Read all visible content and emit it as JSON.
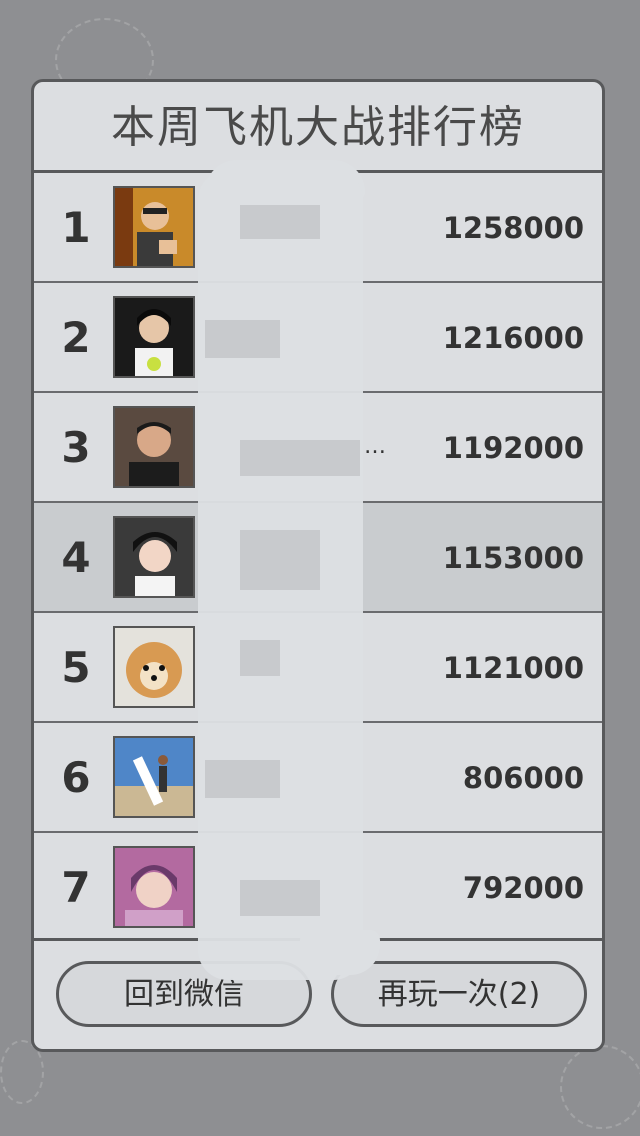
{
  "title": "本周飞机大战排行榜",
  "ranking": [
    {
      "rank": "1",
      "score": "1258000",
      "name_visible": ""
    },
    {
      "rank": "2",
      "score": "1216000",
      "name_visible": ""
    },
    {
      "rank": "3",
      "score": "1192000",
      "name_visible": "…"
    },
    {
      "rank": "4",
      "score": "1153000",
      "name_visible": ""
    },
    {
      "rank": "5",
      "score": "1121000",
      "name_visible": ""
    },
    {
      "rank": "6",
      "score": "806000",
      "name_visible": ""
    },
    {
      "rank": "7",
      "score": "792000",
      "name_visible": ""
    }
  ],
  "buttons": {
    "back": "回到微信",
    "again": "再玩一次(2)"
  },
  "colors": {
    "background": "#8e8f92",
    "panel": "#dcdee1",
    "highlight_row": "#c9cccf",
    "border": "#58595b"
  }
}
